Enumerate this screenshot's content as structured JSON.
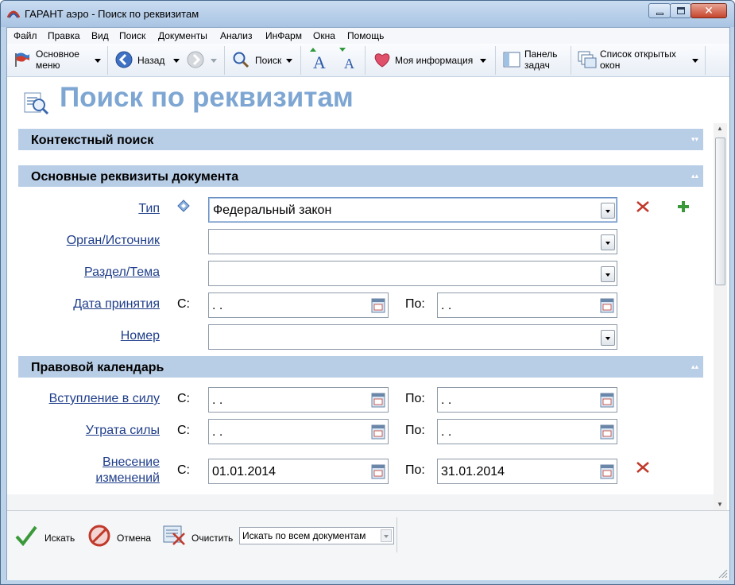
{
  "window": {
    "title": "ГАРАНТ аэро - Поиск по реквизитам",
    "close_glyph": "✕"
  },
  "menu": {
    "items": [
      "Файл",
      "Правка",
      "Вид",
      "Поиск",
      "Документы",
      "Анализ",
      "ИнФарм",
      "Окна",
      "Помощь"
    ]
  },
  "toolbar": {
    "main_menu_label_line1": "Основное",
    "main_menu_label_line2": "меню",
    "back_label": "Назад",
    "search_label": "Поиск",
    "my_info_label": "Моя информация",
    "taskbar_label_line1": "Панель",
    "taskbar_label_line2": "задач",
    "open_windows_label_line1": "Список открытых",
    "open_windows_label_line2": "окон"
  },
  "page": {
    "title": "Поиск по реквизитам"
  },
  "sections": {
    "context_search": "Контекстный поиск",
    "main_requisites": "Основные реквизиты документа",
    "legal_calendar": "Правовой календарь",
    "collapse_glyph": "▾▾",
    "expand_glyph": "▴▴"
  },
  "fields": {
    "type": {
      "label": "Тип",
      "value": "Федеральный закон"
    },
    "organ": {
      "label": "Орган/Источник",
      "value": ""
    },
    "section": {
      "label": "Раздел/Тема",
      "value": ""
    },
    "adoption_date": {
      "label": "Дата принятия",
      "from_prefix": "С:",
      "to_prefix": "По:",
      "from_value": " .  .",
      "to_value": " .  ."
    },
    "number": {
      "label": "Номер",
      "value": ""
    },
    "entry_into_force": {
      "label": "Вступление в силу",
      "from_prefix": "С:",
      "to_prefix": "По:",
      "from_value": " .  .",
      "to_value": " .  ."
    },
    "loss_of_force": {
      "label": "Утрата силы",
      "from_prefix": "С:",
      "to_prefix": "По:",
      "from_value": " .  .",
      "to_value": " .  ."
    },
    "amendments": {
      "label_line1": "Внесение",
      "label_line2": "изменений",
      "from_prefix": "С:",
      "to_prefix": "По:",
      "from_value": "01.01.2014",
      "to_value": "31.01.2014"
    }
  },
  "bottom": {
    "search_button": "Искать",
    "cancel_button": "Отмена",
    "clear_button": "Очистить",
    "scope_select": "Искать по всем документам"
  },
  "colors": {
    "page_title": "#7ea6d3",
    "section_bar": "#b8cde6",
    "link": "#1f3e8a"
  }
}
